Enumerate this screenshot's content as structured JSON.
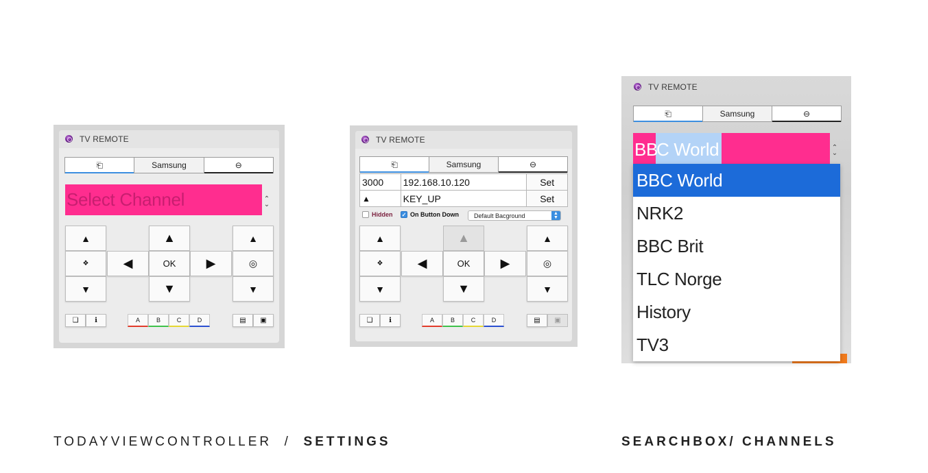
{
  "widget_title": "TV REMOTE",
  "segments": {
    "left_icon": "⎗",
    "middle": "Samsung",
    "right_icon": "⊖"
  },
  "widget1": {
    "channel_placeholder": "Select Channel",
    "stepper": "⌃⌄",
    "left_pad": {
      "up": "▲",
      "center": "❖",
      "down": "▼"
    },
    "dpad": {
      "up": "▲",
      "left": "◀",
      "ok": "OK",
      "right": "▶",
      "down": "▼"
    },
    "right_pad": {
      "up": "▲",
      "center": "◎",
      "down": "▼"
    },
    "bottom": {
      "btn1": "❏",
      "btn2": "ℹ",
      "a": "A",
      "b": "B",
      "c": "C",
      "d": "D",
      "btn3": "▤",
      "btn4": "▣"
    }
  },
  "widget2": {
    "row1": {
      "port": "3000",
      "ip": "192.168.10.120",
      "set": "Set"
    },
    "row2": {
      "key_icon": "▲",
      "key": "KEY_UP",
      "set": "Set"
    },
    "options": {
      "hidden": "Hidden",
      "hidden_checked": false,
      "on_button_down": "On Button Down",
      "on_button_down_checked": true,
      "background": "Default Bacground"
    },
    "left_pad": {
      "up": "▲",
      "center": "❖",
      "down": "▼"
    },
    "dpad": {
      "up": "▲",
      "left": "◀",
      "ok": "OK",
      "right": "▶",
      "down": "▼"
    },
    "right_pad": {
      "up": "▲",
      "center": "◎",
      "down": "▼"
    },
    "bottom": {
      "btn1": "❏",
      "btn2": "ℹ",
      "a": "A",
      "b": "B",
      "c": "C",
      "d": "D",
      "btn3": "▤",
      "btn4": "▣"
    }
  },
  "widget3": {
    "search_value_prefix": "BB",
    "search_value_selected": "C World",
    "channels": [
      "BBC World",
      "NRK2",
      "BBC Brit",
      "TLC Norge",
      "History",
      "TV3"
    ],
    "selected_index": 0
  },
  "captions": {
    "left_normal": "TODAYVIEWCONTROLLER  /  ",
    "left_bold": "SETTINGS",
    "right": "SEARCHBOX/ CHANNELS"
  },
  "colors": {
    "accent_pink": "#ff2d8f",
    "selection_blue": "#1c6bd9",
    "key_a": "#e23b2a",
    "key_b": "#3ec24a",
    "key_c": "#e6d832",
    "key_d": "#2a4fd1"
  }
}
